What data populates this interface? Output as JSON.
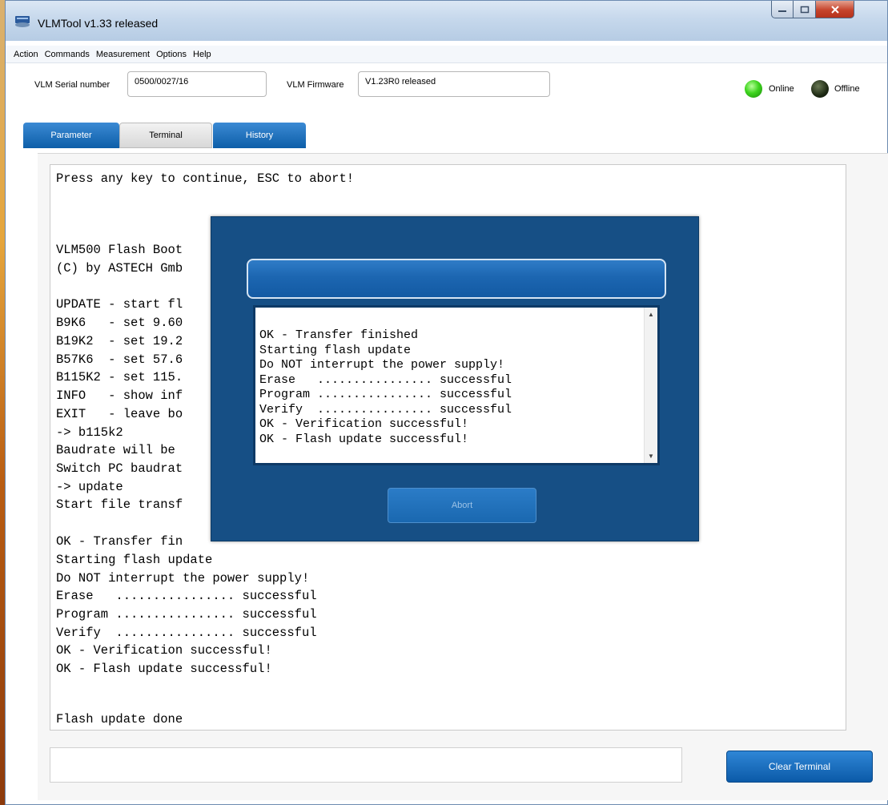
{
  "window": {
    "title": "VLMTool  v1.33 released"
  },
  "menu": [
    "Action",
    "Commands",
    "Measurement",
    "Options",
    "Help"
  ],
  "device": {
    "serial_label": "VLM Serial number",
    "serial_value": "0500/0027/16",
    "firmware_label": "VLM Firmware",
    "firmware_value": "V1.23R0 released",
    "online_label": "Online",
    "offline_label": "Offline"
  },
  "tabs": [
    {
      "label": "Parameter"
    },
    {
      "label": "Terminal"
    },
    {
      "label": "History"
    }
  ],
  "terminal": {
    "lines": [
      "Press any key to continue, ESC to abort!",
      "VLM500 Flash Boot",
      "(C) by ASTECH Gmb",
      "UPDATE - start fl",
      "B9K6   - set 9.60",
      "B19K2  - set 19.2",
      "B57K6  - set 57.6",
      "B115K2 - set 115.",
      "INFO   - show inf",
      "EXIT   - leave bo",
      "-> b115k2",
      "Baudrate will be",
      "Switch PC baudrat",
      "-> update",
      "Start file transf",
      "OK - Transfer fin",
      "Starting flash update",
      "Do NOT interrupt the power supply!",
      "Erase   ................ successful",
      "Program ................ successful",
      "Verify  ................ successful",
      "OK - Verification successful!",
      "OK - Flash update successful!",
      "Flash update done"
    ],
    "clear_label": "Clear Terminal"
  },
  "dialog": {
    "header": "",
    "log": [
      "OK - Transfer finished",
      "Starting flash update",
      "Do NOT interrupt the power supply!",
      "Erase   ................ successful",
      "Program ................ successful",
      "Verify  ................ successful",
      "OK - Verification successful!",
      "OK - Flash update successful!"
    ],
    "abort_label": "Abort"
  },
  "colors": {
    "tab_blue": "#0d5ea8",
    "dialog_bg": "#164f85",
    "led_online": "#3ed41e",
    "led_offline": "#1e2a14"
  }
}
